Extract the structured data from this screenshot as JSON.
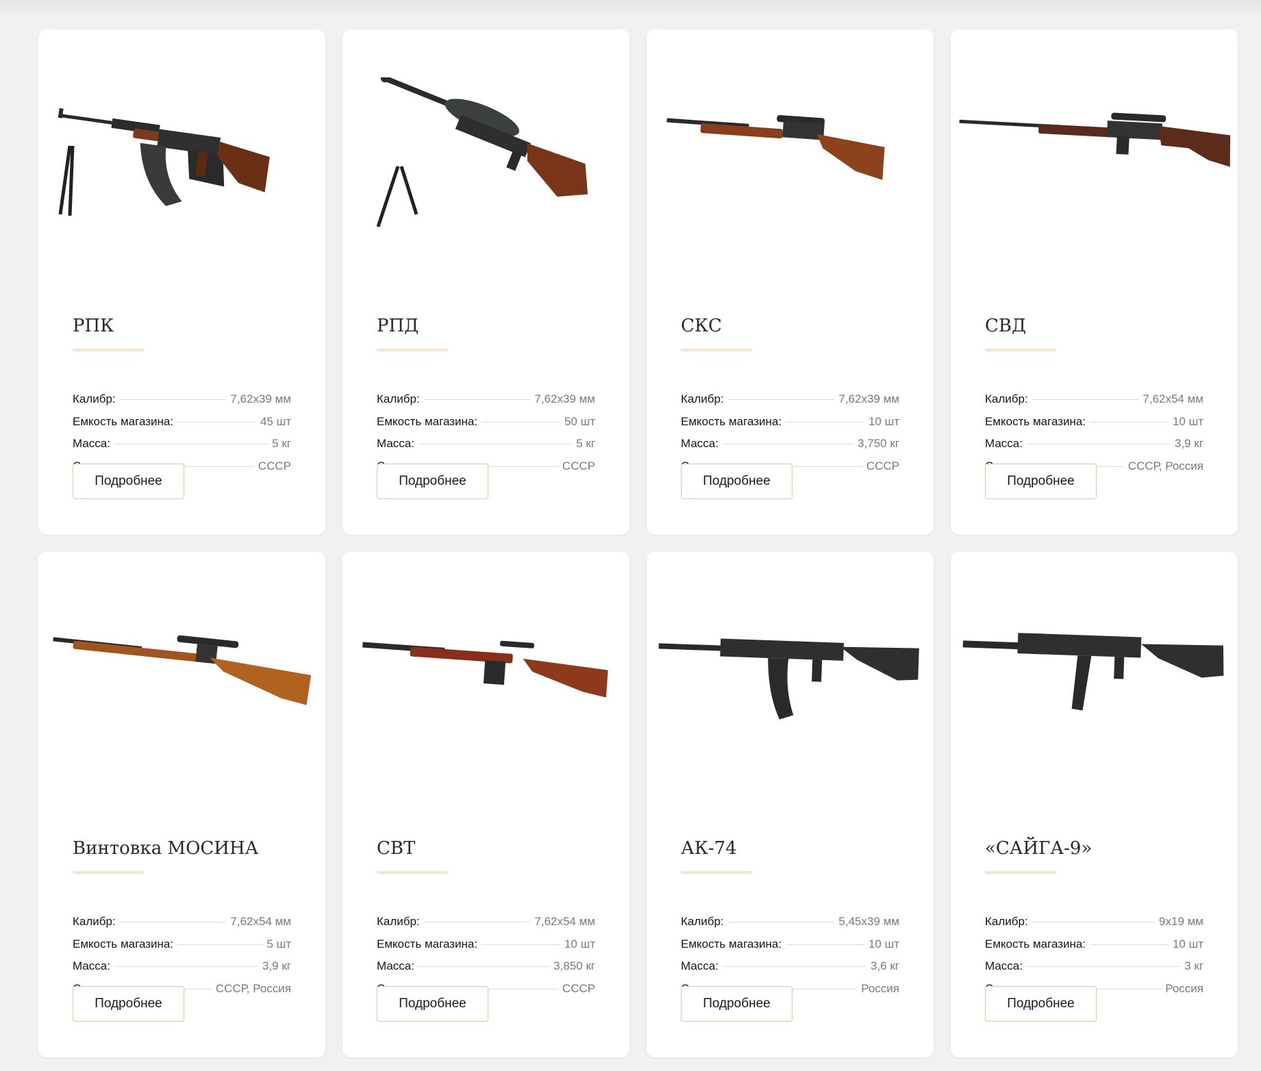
{
  "labels": {
    "caliber": "Калибр:",
    "magazine": "Емкость магазина:",
    "mass": "Масса:",
    "country": "Страна:",
    "more_button": "Подробнее"
  },
  "cards": [
    {
      "title": "РПК",
      "caliber": "7,62x39 мм",
      "magazine": "45 шт",
      "mass": "5 кг",
      "country": "СССР",
      "image": "rpk-machine-gun-image"
    },
    {
      "title": "РПД",
      "caliber": "7,62x39 мм",
      "magazine": "50 шт",
      "mass": "5 кг",
      "country": "СССР",
      "image": "rpd-machine-gun-image"
    },
    {
      "title": "СКС",
      "caliber": "7,62x39 мм",
      "magazine": "10 шт",
      "mass": "3,750 кг",
      "country": "СССР",
      "image": "sks-carbine-image"
    },
    {
      "title": "СВД",
      "caliber": "7,62x54 мм",
      "magazine": "10 шт",
      "mass": "3,9 кг",
      "country": "СССР, Россия",
      "image": "svd-sniper-rifle-image"
    },
    {
      "title": "Винтовка МОСИНА",
      "caliber": "7,62x54 мм",
      "magazine": "5 шт",
      "mass": "3,9 кг",
      "country": "СССР, Россия",
      "image": "mosin-rifle-image"
    },
    {
      "title": "СВТ",
      "caliber": "7,62x54 мм",
      "magazine": "10 шт",
      "mass": "3,850 кг",
      "country": "СССР",
      "image": "svt-rifle-image"
    },
    {
      "title": "АК-74",
      "caliber": "5,45x39 мм",
      "magazine": "10 шт",
      "mass": "3,6 кг",
      "country": "Россия",
      "image": "ak74-rifle-image"
    },
    {
      "title": "«САЙГА-9»",
      "caliber": "9x19 мм",
      "magazine": "10 шт",
      "mass": "3 кг",
      "country": "Россия",
      "image": "saiga9-carbine-image"
    }
  ]
}
